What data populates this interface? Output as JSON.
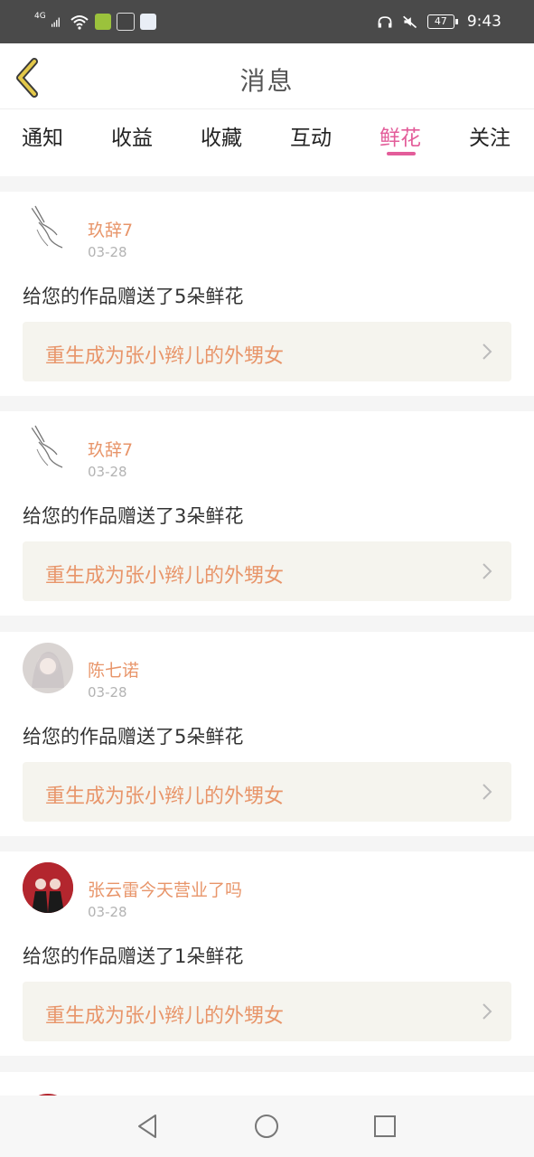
{
  "status_bar": {
    "network": "4G",
    "battery": "47",
    "time": "9:43"
  },
  "header": {
    "title": "消息",
    "back_icon": "chevron-left-icon"
  },
  "tabs": [
    {
      "label": "通知",
      "active": false
    },
    {
      "label": "收益",
      "active": false
    },
    {
      "label": "收藏",
      "active": false
    },
    {
      "label": "互动",
      "active": false
    },
    {
      "label": "鲜花",
      "active": true
    },
    {
      "label": "关注",
      "active": false
    }
  ],
  "messages": [
    {
      "user": "玖辞7",
      "date": "03-28",
      "text": "给您的作品赠送了5朵鲜花",
      "work": "重生成为张小辫儿的外甥女"
    },
    {
      "user": "玖辞7",
      "date": "03-28",
      "text": "给您的作品赠送了3朵鲜花",
      "work": "重生成为张小辫儿的外甥女"
    },
    {
      "user": "陈七诺",
      "date": "03-28",
      "text": "给您的作品赠送了5朵鲜花",
      "work": "重生成为张小辫儿的外甥女"
    },
    {
      "user": "张云雷今天营业了吗",
      "date": "03-28",
      "text": "给您的作品赠送了1朵鲜花",
      "work": "重生成为张小辫儿的外甥女"
    }
  ],
  "colors": {
    "accent": "#e35d9a",
    "username": "#e8956a",
    "status_bar_bg": "#4a4a4a",
    "work_bg": "#f5f4ee"
  }
}
